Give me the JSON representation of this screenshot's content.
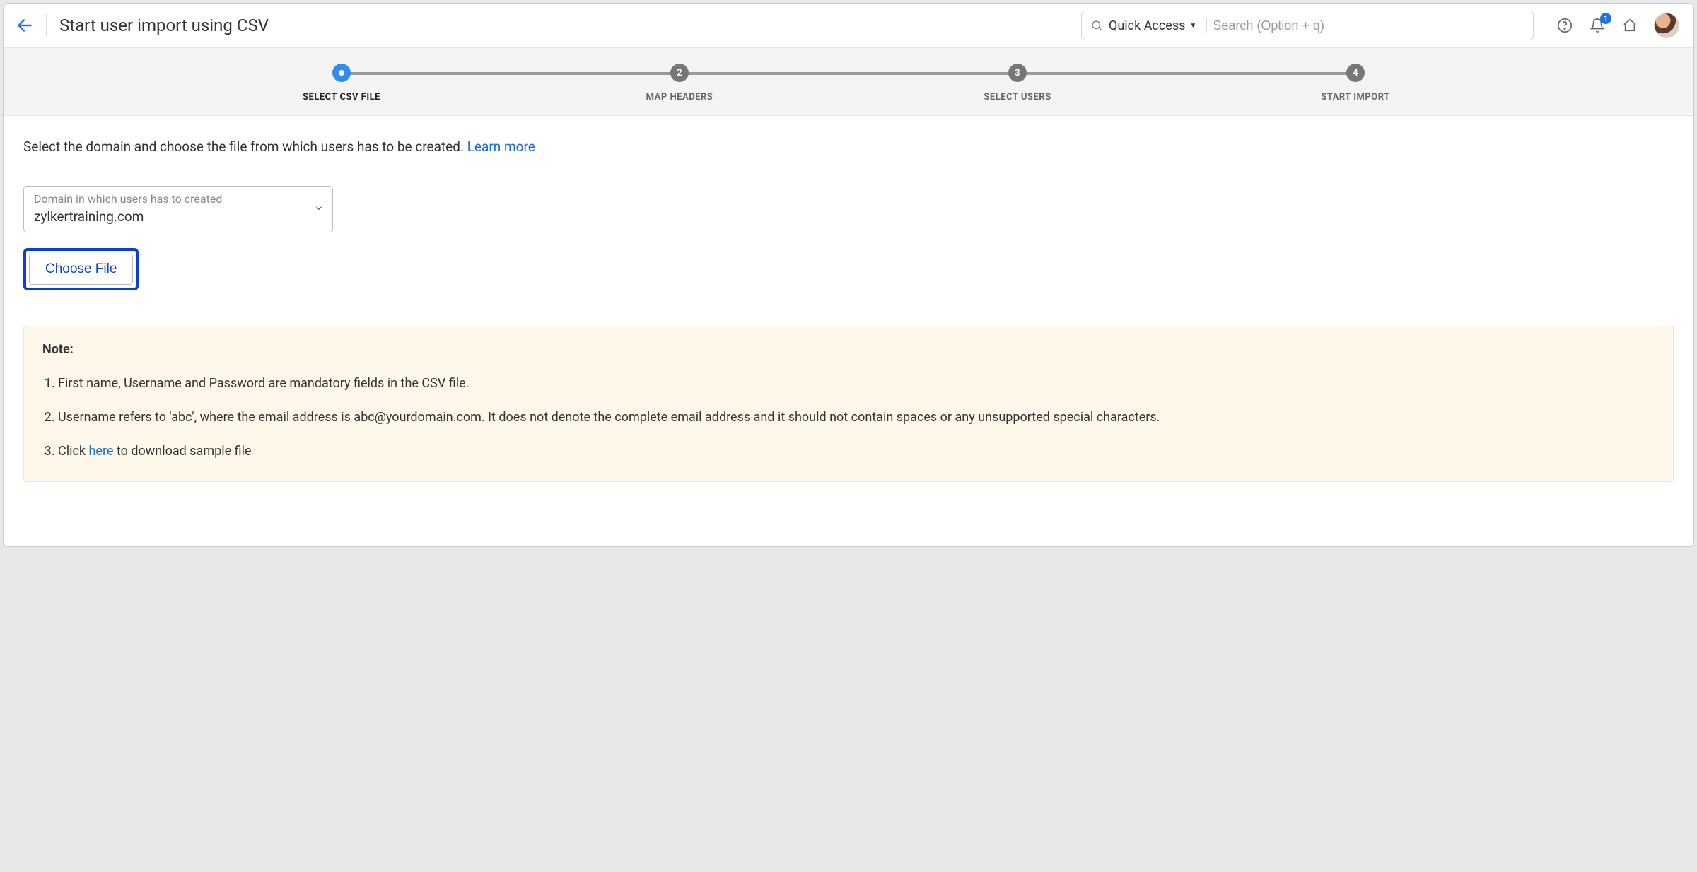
{
  "header": {
    "title": "Start user import using CSV",
    "quick_access_label": "Quick Access",
    "search_placeholder": "Search (Option + q)",
    "notification_count": "1"
  },
  "stepper": {
    "steps": [
      {
        "num": "",
        "label": "SELECT CSV FILE"
      },
      {
        "num": "2",
        "label": "MAP HEADERS"
      },
      {
        "num": "3",
        "label": "SELECT USERS"
      },
      {
        "num": "4",
        "label": "START IMPORT"
      }
    ]
  },
  "content": {
    "instruction_pre": "Select the domain and choose the file from which users has to be created. ",
    "learn_more": "Learn more",
    "domain_label": "Domain in which users has to created",
    "domain_value": "zylkertraining.com",
    "choose_file": "Choose File",
    "note_heading": "Note:",
    "notes": {
      "n1": "First name, Username and Password are mandatory fields in the CSV file.",
      "n2": "Username refers to 'abc', where the email address is abc@yourdomain.com. It does not denote the complete email address and it should not contain spaces or any unsupported special characters.",
      "n3_pre": "Click ",
      "n3_link": "here",
      "n3_post": " to download sample file"
    }
  }
}
